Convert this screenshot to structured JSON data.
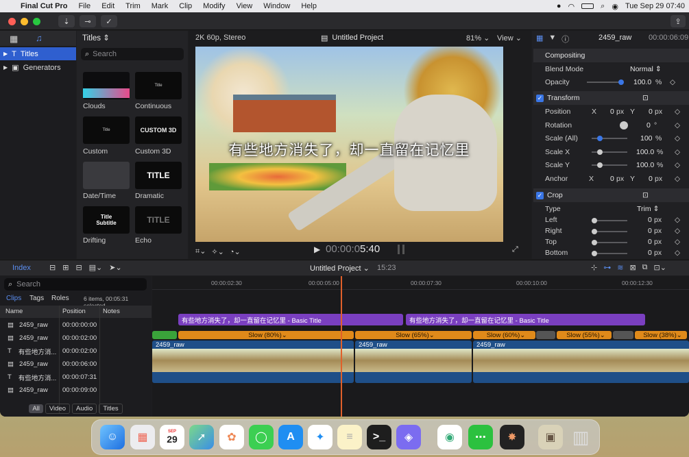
{
  "menubar": {
    "app_name": "Final Cut Pro",
    "menus": [
      "File",
      "Edit",
      "Trim",
      "Mark",
      "Clip",
      "Modify",
      "View",
      "Window",
      "Help"
    ],
    "datetime": "Tue Sep 29  07:40"
  },
  "browser": {
    "header": "Titles",
    "search_placeholder": "Search",
    "sidebar": [
      "Titles",
      "Generators"
    ],
    "tiles": [
      {
        "name": "Clouds",
        "preview": ""
      },
      {
        "name": "Continuous",
        "preview": "Title"
      },
      {
        "name": "Custom",
        "preview": "Title"
      },
      {
        "name": "Custom 3D",
        "preview": "CUSTOM 3D"
      },
      {
        "name": "Date/Time",
        "preview": ""
      },
      {
        "name": "Dramatic",
        "preview": "TITLE"
      },
      {
        "name": "Drifting",
        "preview": "Title\nSubtitle"
      },
      {
        "name": "Echo",
        "preview": "TITLE"
      }
    ]
  },
  "viewer": {
    "format": "2K 60p, Stereo",
    "project": "Untitled Project",
    "zoom": "81%",
    "view_label": "View",
    "subtitle": "有些地方消失了，却一直留在记忆里",
    "timecode_dim": "00:00:0",
    "timecode": "5:40"
  },
  "inspector": {
    "clip_name": "2459_raw",
    "duration": "00:00:06:09",
    "compositing": "Compositing",
    "blend_mode_label": "Blend Mode",
    "blend_mode_value": "Normal",
    "opacity_label": "Opacity",
    "opacity_value": "100.0",
    "opacity_unit": "%",
    "transform": "Transform",
    "position_label": "Position",
    "x": "X",
    "y": "Y",
    "position_x": "0",
    "position_y": "0",
    "px": "px",
    "rotation_label": "Rotation",
    "rotation_value": "0",
    "deg": "°",
    "scale_all_label": "Scale (All)",
    "scale_all_value": "100",
    "scale_x_label": "Scale X",
    "scale_x_value": "100.0",
    "scale_y_label": "Scale Y",
    "scale_y_value": "100.0",
    "anchor_label": "Anchor",
    "anchor_x": "0",
    "anchor_y": "0",
    "crop": "Crop",
    "type_label": "Type",
    "type_value": "Trim",
    "left_label": "Left",
    "left_value": "0",
    "right_label": "Right",
    "right_value": "0",
    "top_label": "Top",
    "top_value": "0",
    "bottom_label": "Bottom",
    "bottom_value": "0"
  },
  "timeline": {
    "index_label": "Index",
    "project": "Untitled Project",
    "duration": "15:23",
    "search_placeholder": "Search",
    "tabs": [
      "Clips",
      "Tags",
      "Roles"
    ],
    "selection_info": "6 items, 00:05:31 selected",
    "columns": [
      "Name",
      "Position",
      "Notes"
    ],
    "rows": [
      {
        "name": "2459_raw",
        "position": "00:00:00:00"
      },
      {
        "name": "2459_raw",
        "position": "00:00:02:00"
      },
      {
        "name": "有些地方消...",
        "position": "00:00:02:00"
      },
      {
        "name": "2459_raw",
        "position": "00:00:06:00"
      },
      {
        "name": "有些地方消...",
        "position": "00:00:07:31"
      },
      {
        "name": "2459_raw",
        "position": "00:00:09:00"
      }
    ],
    "filters": [
      "All",
      "Video",
      "Audio",
      "Titles"
    ],
    "ruler": [
      "00:00:02:30",
      "00:00:05:00",
      "00:00:07:30",
      "00:00:10:00",
      "00:00:12:30"
    ],
    "title_clips": [
      "有些地方消失了，却一直留在记忆里 - Basic Title",
      "有些地方消失了，却一直留在记忆里 - Basic Title"
    ],
    "speeds": [
      "Slow (80%)",
      "Slow (65%)",
      "Slow (60%)",
      "Slow (55%)",
      "Slow (38%)"
    ],
    "video_clips": [
      "2459_raw",
      "2459_raw",
      "2459_raw"
    ]
  },
  "dock": {
    "calendar_month": "SEP",
    "calendar_day": "29"
  },
  "colors": {
    "accent": "#2f5fcf",
    "playhead": "#e0602a",
    "title_clip": "#7a3fc0",
    "speed_bar": "#e08a1a",
    "video_clip": "#1f4f88"
  }
}
